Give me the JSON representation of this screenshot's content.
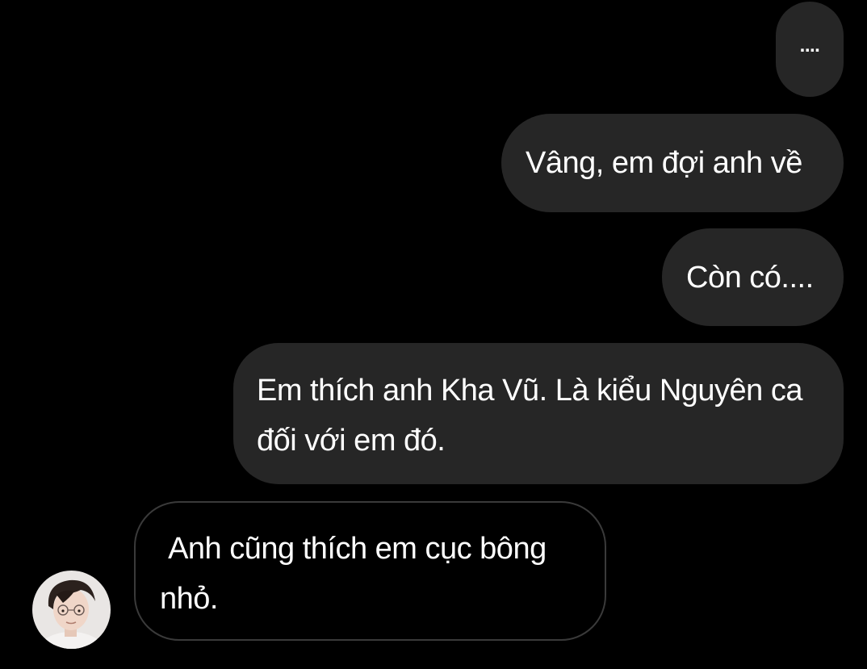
{
  "conversation": {
    "messages": [
      {
        "sender": "me",
        "text": "...."
      },
      {
        "sender": "me",
        "text": "Vâng, em đợi anh về"
      },
      {
        "sender": "me",
        "text": "Còn có...."
      },
      {
        "sender": "me",
        "text": "Em thích anh Kha Vũ. Là kiểu Nguyên ca đối với em đó."
      },
      {
        "sender": "other",
        "text": " Anh cũng thích em cục bông nhỏ."
      }
    ]
  },
  "contact": {
    "avatar_icon": "avatar"
  },
  "colors": {
    "background": "#000000",
    "sent_bubble": "#262626",
    "received_bubble_border": "#3a3a3a",
    "text": "#ffffff"
  }
}
